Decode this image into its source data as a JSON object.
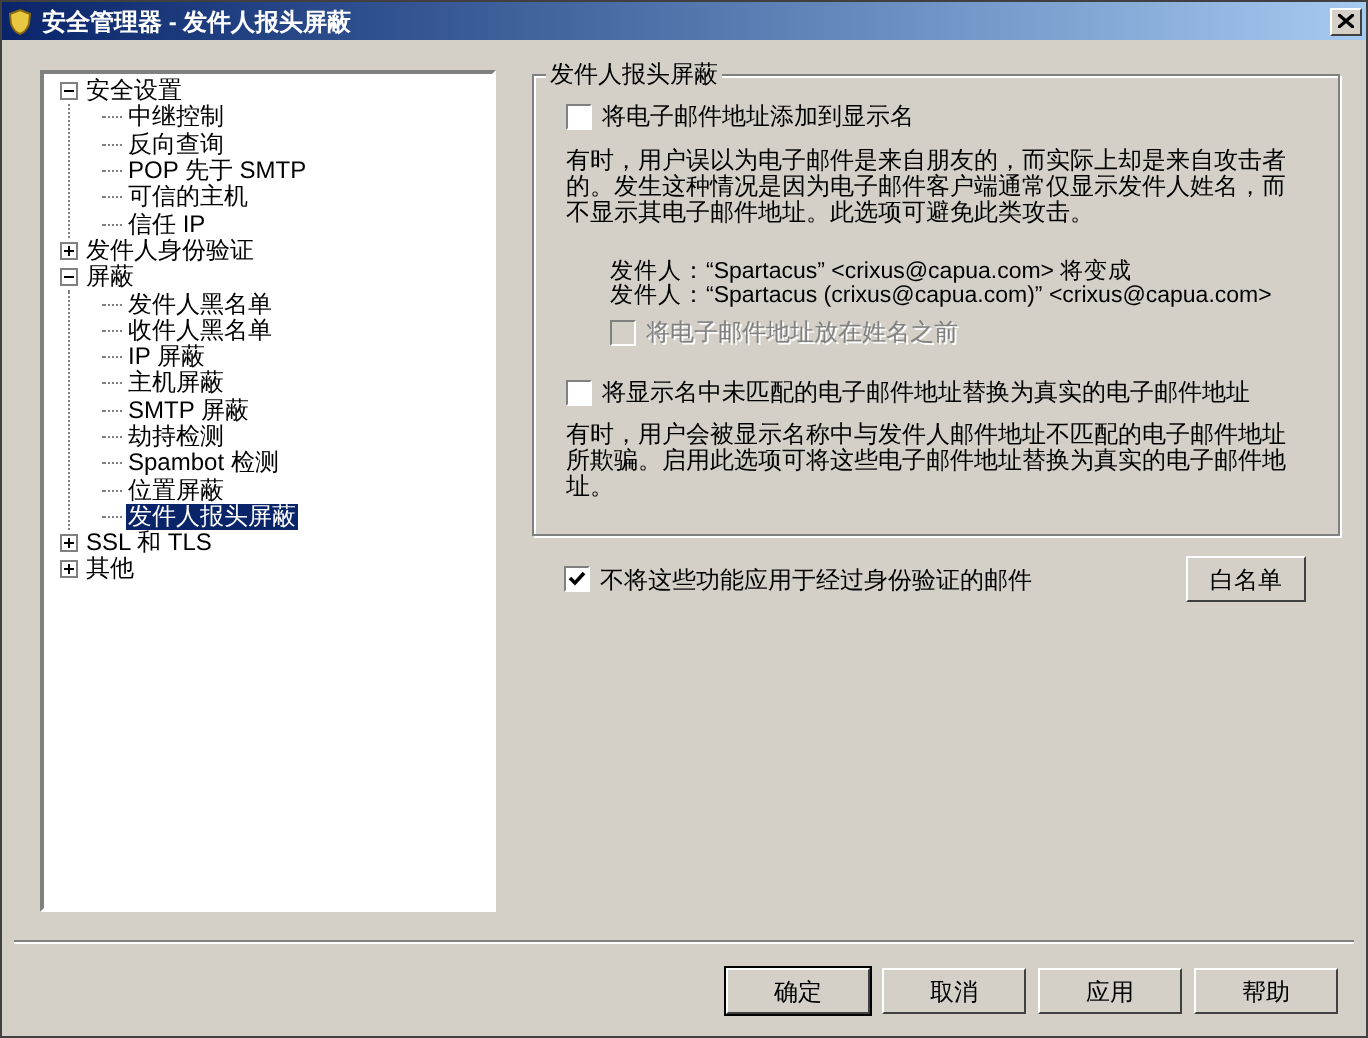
{
  "window": {
    "title": "安全管理器 - 发件人报头屏蔽"
  },
  "tree": [
    {
      "label": "安全设置",
      "expanded": true,
      "selected": false,
      "children": [
        {
          "label": "中继控制",
          "selected": false
        },
        {
          "label": "反向查询",
          "selected": false
        },
        {
          "label": "POP 先于 SMTP",
          "selected": false
        },
        {
          "label": "可信的主机",
          "selected": false
        },
        {
          "label": "信任 IP",
          "selected": false
        }
      ]
    },
    {
      "label": "发件人身份验证",
      "expanded": false,
      "selected": false
    },
    {
      "label": "屏蔽",
      "expanded": true,
      "selected": false,
      "children": [
        {
          "label": "发件人黑名单",
          "selected": false
        },
        {
          "label": "收件人黑名单",
          "selected": false
        },
        {
          "label": "IP 屏蔽",
          "selected": false
        },
        {
          "label": "主机屏蔽",
          "selected": false
        },
        {
          "label": "SMTP 屏蔽",
          "selected": false
        },
        {
          "label": "劫持检测",
          "selected": false
        },
        {
          "label": "Spambot 检测",
          "selected": false
        },
        {
          "label": "位置屏蔽",
          "selected": false
        },
        {
          "label": "发件人报头屏蔽",
          "selected": true
        }
      ]
    },
    {
      "label": "SSL 和 TLS",
      "expanded": false,
      "selected": false
    },
    {
      "label": "其他",
      "expanded": false,
      "selected": false
    }
  ],
  "group": {
    "title": "发件人报头屏蔽",
    "option1": {
      "label": "将电子邮件地址添加到显示名",
      "checked": false
    },
    "description1": "有时，用户误以为电子邮件是来自朋友的，而实际上却是来自攻击者的。发生这种情况是因为电子邮件客户端通常仅显示发件人姓名，而不显示其电子邮件地址。此选项可避免此类攻击。",
    "example": [
      "发件人：“Spartacus” <crixus@capua.com> 将变成",
      "发件人：“Spartacus (crixus@capua.com)” <crixus@capua.com>"
    ],
    "sub_option": {
      "label": "将电子邮件地址放在姓名之前",
      "checked": false,
      "disabled": true
    },
    "option2": {
      "label": "将显示名中未匹配的电子邮件地址替换为真实的电子邮件地址",
      "checked": false
    },
    "description2": "有时，用户会被显示名称中与发件人邮件地址不匹配的电子邮件地址所欺骗。启用此选项可将这些电子邮件地址替换为真实的电子邮件地址。"
  },
  "exclude_authenticated": {
    "label": "不将这些功能应用于经过身份验证的邮件",
    "checked": true
  },
  "whitelist_button": "白名单",
  "buttons": [
    {
      "label": "确定",
      "default": true
    },
    {
      "label": "取消",
      "default": false
    },
    {
      "label": "应用",
      "default": false
    },
    {
      "label": "帮助",
      "default": false
    }
  ]
}
